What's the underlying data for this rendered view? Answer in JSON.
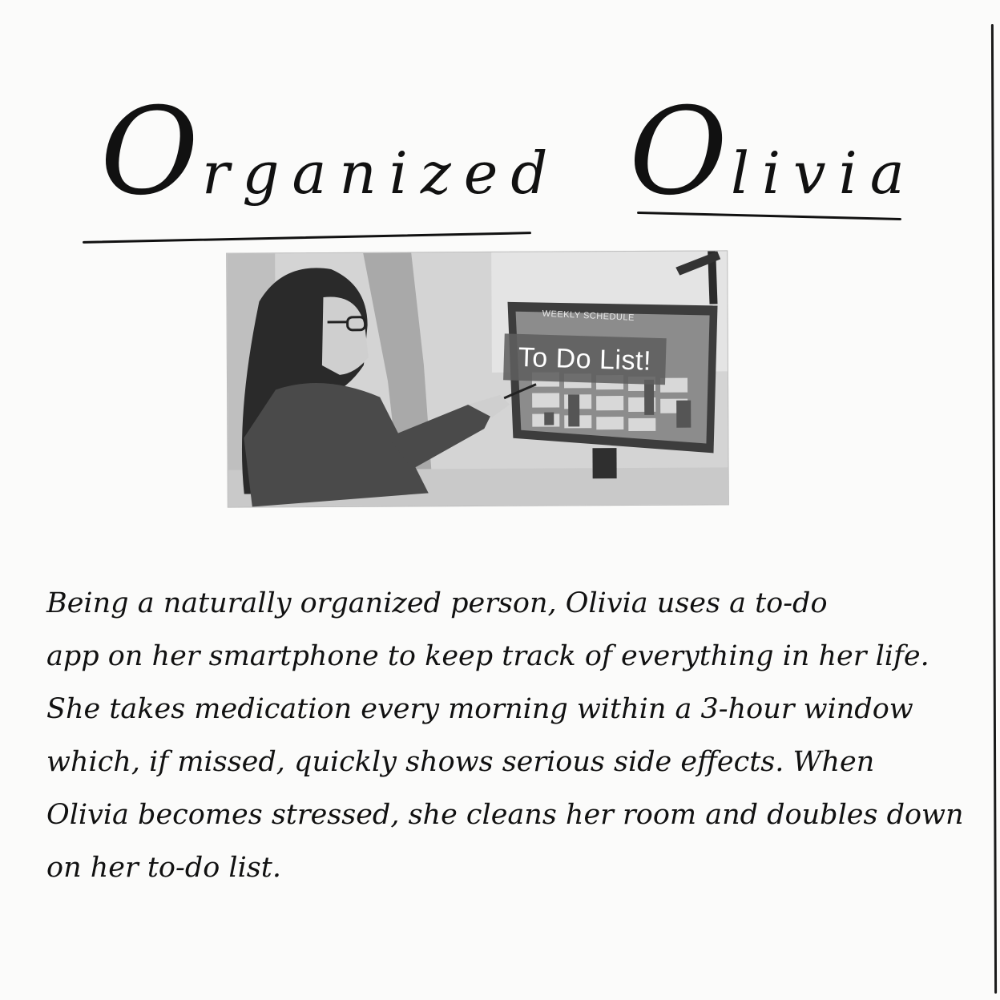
{
  "title": {
    "word1": {
      "initial": "O",
      "rest": "rganized"
    },
    "word2": {
      "initial": "O",
      "rest": "livia"
    }
  },
  "photo": {
    "banner_text": "To Do List!",
    "screen_label": "WEEKLY SCHEDULE"
  },
  "description": {
    "lines": [
      "Being a naturally organized person, Olivia uses a to-do",
      "app on her smartphone to keep track of everything in her life.",
      "She takes medication every morning within a 3-hour window",
      "which, if missed, quickly shows serious side effects. When",
      "Olivia becomes stressed, she cleans her room and doubles down",
      "on her to-do list."
    ]
  }
}
